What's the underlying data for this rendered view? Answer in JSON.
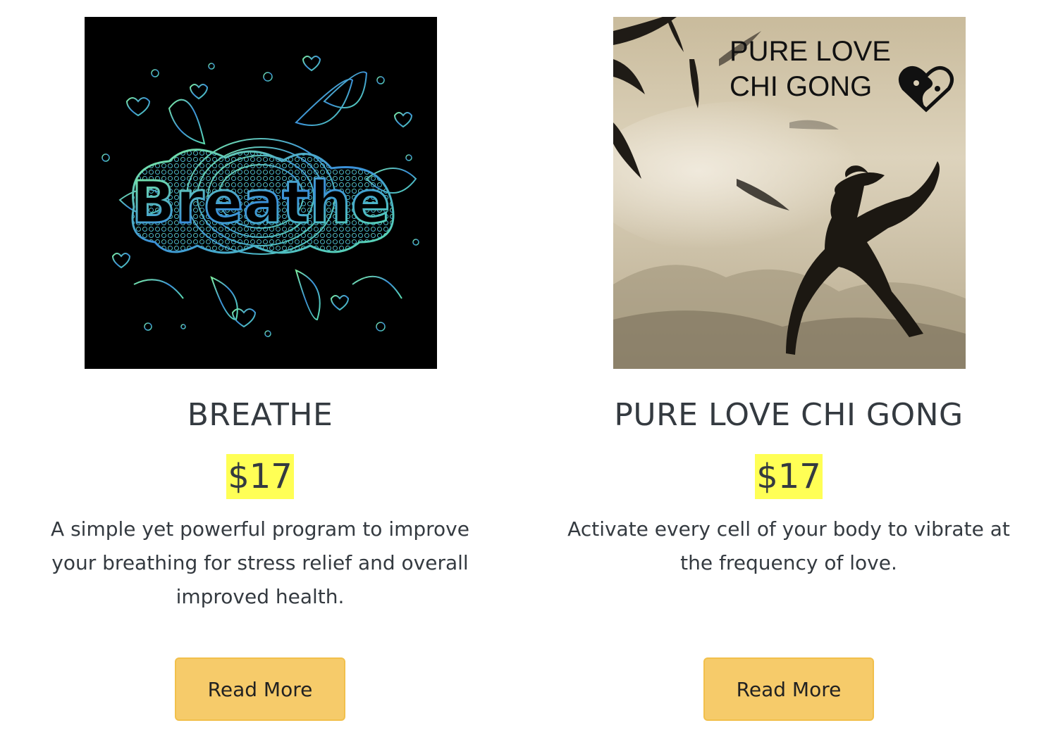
{
  "products": [
    {
      "title": "BREATHE",
      "price": "$17",
      "description": "A simple yet powerful program to improve your breathing for stress relief and overall improved health.",
      "button_label": "Read More",
      "image": {
        "icon": "breathe-doodle-image",
        "text": "Breathe",
        "background": "#000000",
        "accent_colors": [
          "#5ee0b0",
          "#3a8fd9",
          "#7ef0a0"
        ]
      }
    },
    {
      "title": "PURE LOVE CHI GONG",
      "price": "$17",
      "description": "Activate every cell of your body to vibrate at the frequency of love.",
      "button_label": "Read More",
      "image": {
        "icon": "chi-gong-ink-painting-image",
        "text_line1": "PURE LOVE",
        "text_line2": "CHI GONG",
        "heart_icon": "yin-yang-heart-icon",
        "background": "#d8cdb4"
      }
    }
  ],
  "colors": {
    "price_highlight": "#ffff55",
    "button_bg": "#f6cb6a",
    "text": "#343a40"
  }
}
